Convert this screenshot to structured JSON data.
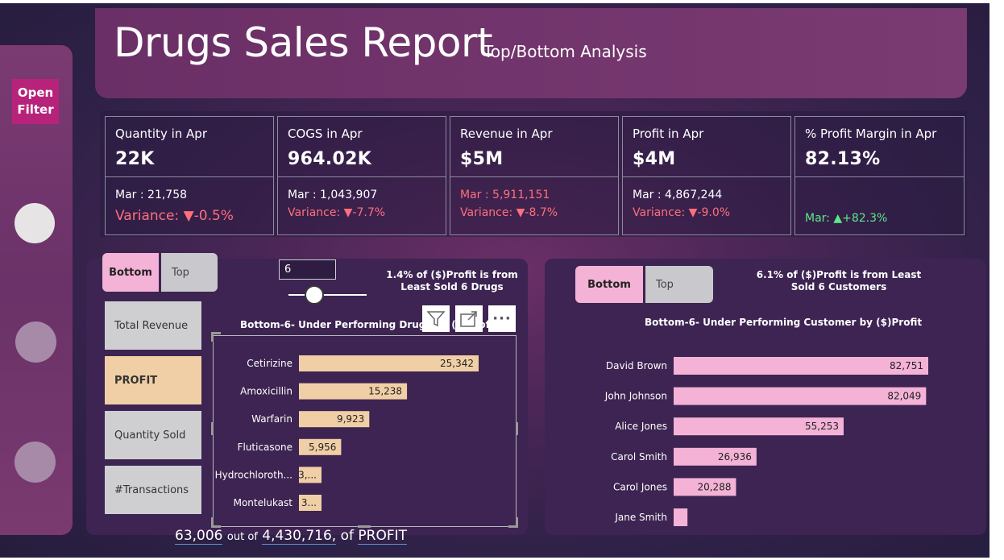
{
  "header": {
    "title": "Drugs Sales Report",
    "subtitle": "Top/Bottom Analysis"
  },
  "rail": {
    "open_filter": "Open Filter"
  },
  "kpis": [
    {
      "label": "Quantity in Apr",
      "value": "22K",
      "mar": "Mar : 21,758",
      "variance": "Variance: ▼-0.5%"
    },
    {
      "label": "COGS in Apr",
      "value": "964.02K",
      "mar": "Mar : 1,043,907",
      "variance": "Variance: ▼-7.7%"
    },
    {
      "label": "Revenue in Apr",
      "value": "$5M",
      "mar": "Mar : 5,911,151",
      "variance": "Variance: ▼-8.7%"
    },
    {
      "label": "Profit in Apr",
      "value": "$4M",
      "mar": "Mar : 4,867,244",
      "variance": "Variance: ▼-9.0%"
    },
    {
      "label": "% Profit Margin in Apr",
      "value": "82.13%",
      "mar": "",
      "variance": "Mar: ▲+82.3%"
    }
  ],
  "left_panel": {
    "tab_bottom": "Bottom",
    "tab_top": "Top",
    "n_value": "6",
    "slider_fraction": 0.3,
    "note": "1.4% of ($)Profit is from Least Sold 6 Drugs",
    "metrics": [
      "Total Revenue",
      "PROFIT",
      "Quantity Sold",
      "#Transactions"
    ],
    "active_metric": "PROFIT",
    "chart_title": "Bottom-6- Under Performing Drugs by ($)Profit",
    "tools": {
      "filter_icon": "filter-icon",
      "focus_icon": "focus-mode-icon",
      "more_icon": "more-options-icon",
      "more_label": "···"
    }
  },
  "right_panel": {
    "tab_bottom": "Bottom",
    "tab_top": "Top",
    "note": "6.1% of ($)Profit is from Least Sold 6 Customers",
    "chart_title": "Bottom-6- Under Performing Customer by ($)Profit"
  },
  "footer": {
    "part1": "63,006",
    "part2": "out of",
    "part3": "4,430,716,",
    "part4": "of",
    "part5": "PROFIT"
  },
  "colors": {
    "drug_bar": "#f1cfa6",
    "customer_bar": "#f3b2d6",
    "accent": "#b7237a"
  },
  "chart_data": [
    {
      "type": "bar",
      "orientation": "horizontal",
      "title": "Bottom-6- Under Performing Drugs by ($)Profit",
      "categories": [
        "Cetirizine",
        "Amoxicillin",
        "Warfarin",
        "Fluticasone",
        "Hydrochloroth...",
        "Montelukast"
      ],
      "values": [
        25342,
        15238,
        9923,
        5956,
        3000,
        3000
      ],
      "labels": [
        "25,342",
        "15,238",
        "9,923",
        "5,956",
        "3,...",
        "3..."
      ]
    },
    {
      "type": "bar",
      "orientation": "horizontal",
      "title": "Bottom-6- Under Performing Customer by ($)Profit",
      "categories": [
        "David Brown",
        "John Johnson",
        "Alice Jones",
        "Carol Smith",
        "Carol Jones",
        "Jane Smith"
      ],
      "values": [
        82751,
        82049,
        55253,
        26936,
        20288,
        4500
      ],
      "labels": [
        "82,751",
        "82,049",
        "55,253",
        "26,936",
        "20,288",
        ""
      ]
    }
  ]
}
